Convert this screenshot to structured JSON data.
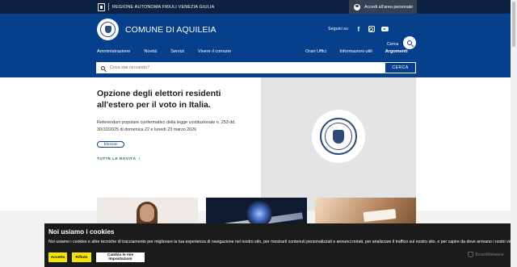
{
  "topbar": {
    "region_name": "REGIONE AUTONOMA FRIULI VENEZIA GIULIA",
    "login_label": "Accedi all'area personale"
  },
  "header": {
    "site_name": "COMUNE DI AQUILEIA",
    "follow_label": "Seguici su",
    "search_label": "Cerca",
    "social_icons": [
      "facebook-icon",
      "instagram-icon",
      "youtube-icon"
    ]
  },
  "nav": {
    "left": [
      "Amministrazione",
      "Novità",
      "Servizi",
      "Vivere il comune"
    ],
    "right": [
      "Orari Uffici",
      "Informazioni utili",
      "Argomenti"
    ]
  },
  "search": {
    "placeholder": "Cosa stai cercando?",
    "button_label": "CERCA"
  },
  "hero": {
    "title": "Opzione degli elettori residenti all'estero per il voto in Italia.",
    "description": "Referendum popolare confermativo della legge costituzionale n. 253 dd. 30/10/2025 di domenica 22 e lunedì 23 marzo 2026",
    "tag": "Elezioni",
    "all_news": "TUTTE LE NOVITÀ"
  },
  "cookie": {
    "title": "Noi usiamo i cookies",
    "text": "Noi usiamo i cookies e altre tecniche di tracciamento per migliorare la tua esperienza di navigazione nel nostro sito, per mostrarti contenuti personalizzati e annunci mirati, per analizzare il traffico sul nostro sito, e per capire da dove arrivano i nostri visitatori.",
    "accept": "Accetto",
    "reject": "Rifiuto",
    "customize": "Cambia le mie impostazioni",
    "badge": "ScanMalware"
  },
  "colors": {
    "brand_blue": "#06408c",
    "topbar_navy": "#0c2240",
    "cookie_yellow": "#f5e400",
    "link_green": "#1a6b5a"
  }
}
